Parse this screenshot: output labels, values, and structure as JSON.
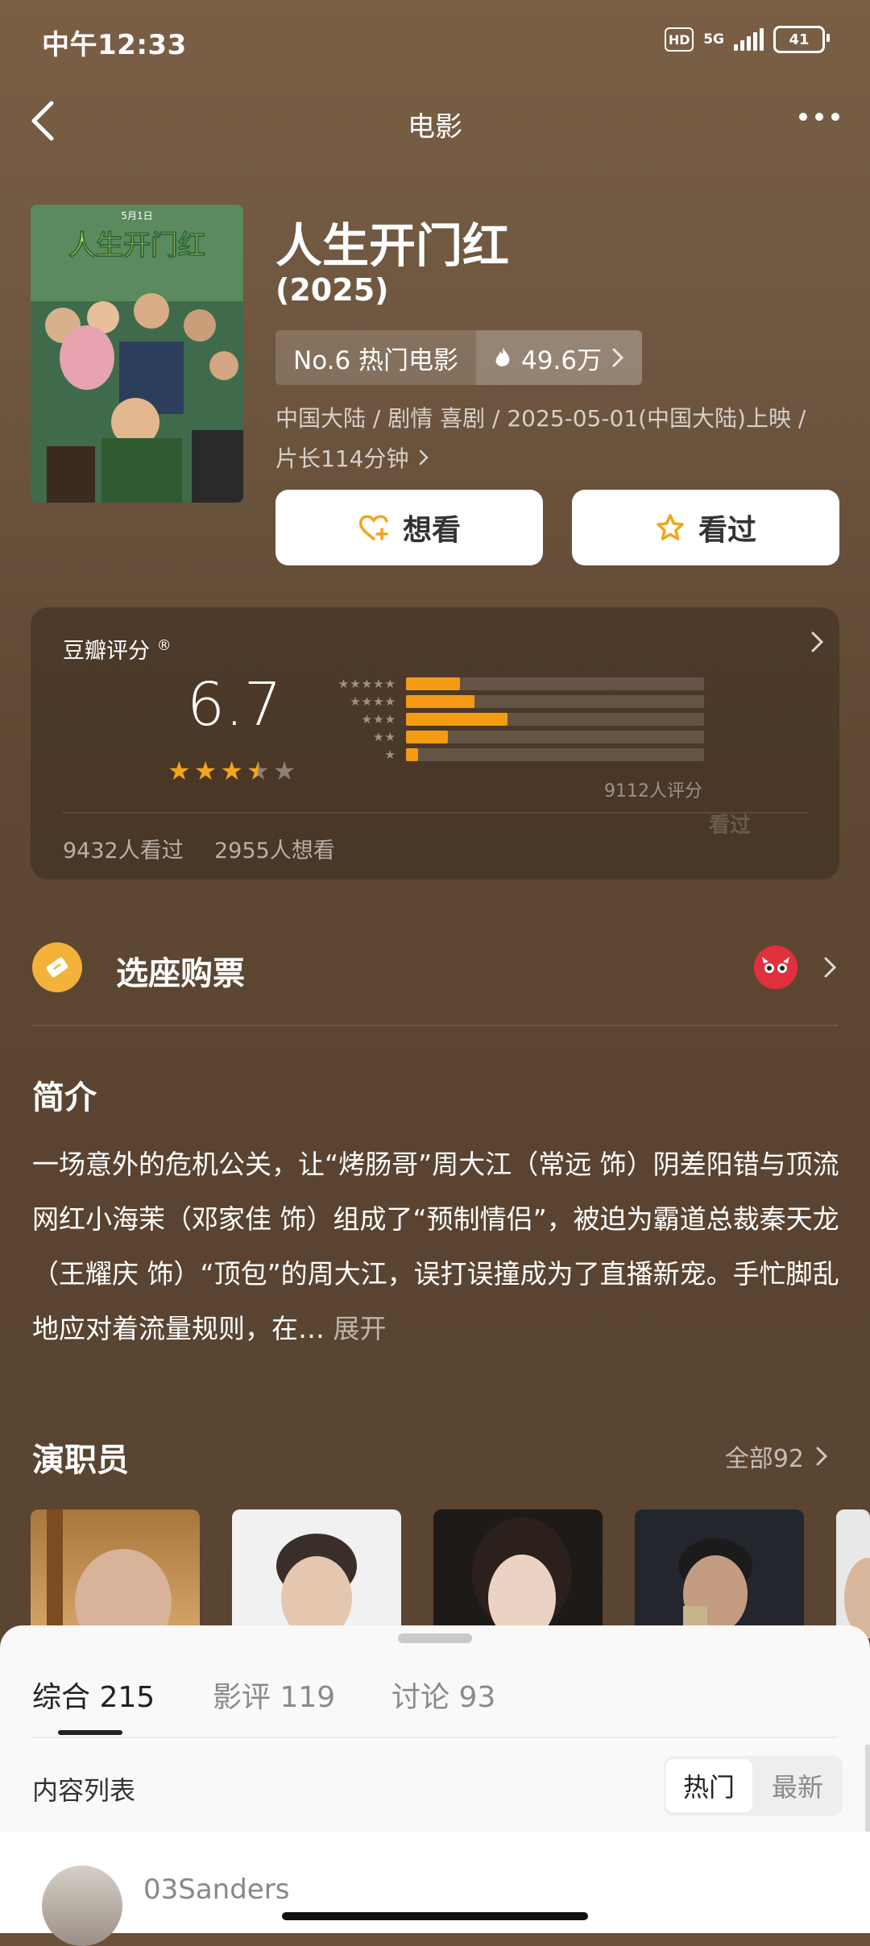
{
  "status": {
    "time": "中午12:33",
    "hd": "HD",
    "network": "5G",
    "battery": "41"
  },
  "nav": {
    "title": "电影"
  },
  "movie": {
    "title": "人生开门红",
    "year": "(2025)",
    "rank": "No.6 热门电影",
    "heat": "49.6万",
    "meta_line1": "中国大陆 / 剧情 喜剧 / 2025-05-01(中国大陆)上映 /",
    "meta_line2": "片长114分钟",
    "poster_title": "人生开门红",
    "poster_date": "5月1日"
  },
  "actions": {
    "want": "想看",
    "seen": "看过"
  },
  "rating": {
    "label": "豆瓣评分",
    "mark": "®",
    "score": "6.7",
    "stars_value": 3.5,
    "distribution": [
      {
        "stars": "★★★★★",
        "pct": 0.18
      },
      {
        "stars": "★★★★",
        "pct": 0.23
      },
      {
        "stars": "★★★",
        "pct": 0.34
      },
      {
        "stars": "★★",
        "pct": 0.14
      },
      {
        "stars": "★",
        "pct": 0.04
      }
    ],
    "count": "9112人评分",
    "seen": "9432人看过",
    "want": "2955人想看",
    "watermark": "看过"
  },
  "ticket": {
    "label": "选座购票"
  },
  "synopsis": {
    "title": "简介",
    "text": "一场意外的危机公关，让“烤肠哥”周大江（常远 饰）阴差阳错与顶流网红小海茉（邓家佳 饰）组成了“预制情侣”，被迫为霸道总裁秦天龙（王耀庆 饰）“顶包”的周大江，误打误撞成为了直播新宠。手忙脚乱地应对着流量规则，在…",
    "expand": "展开"
  },
  "cast": {
    "title": "演职员",
    "all": "全部92"
  },
  "sheet": {
    "tabs": [
      {
        "label": "综合",
        "count": "215"
      },
      {
        "label": "影评",
        "count": "119"
      },
      {
        "label": "讨论",
        "count": "93"
      }
    ],
    "content_label": "内容列表",
    "sort_hot": "热门",
    "sort_new": "最新",
    "first_user": "03Sanders"
  },
  "colors": {
    "accent": "#f59a13",
    "ticket": "#f3b23a",
    "maoyan": "#e0303d"
  }
}
